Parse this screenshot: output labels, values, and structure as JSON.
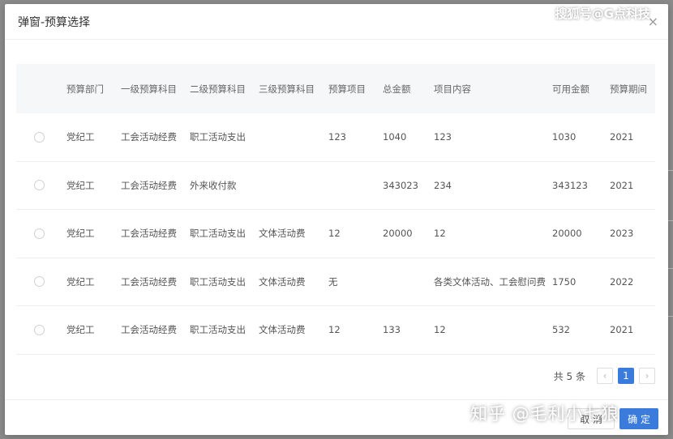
{
  "modal": {
    "title": "弹窗-预算选择",
    "close_glyph": "×"
  },
  "table": {
    "columns": [
      "",
      "预算部门",
      "一级预算科目",
      "二级预算科目",
      "三级预算科目",
      "预算项目",
      "总金额",
      "项目内容",
      "可用金额",
      "预算期间"
    ],
    "rows": [
      {
        "dept": "党纪工",
        "lvl1": "工会活动经费",
        "lvl2": "职工活动支出",
        "lvl3": "",
        "item": "123",
        "total": "1040",
        "content": "123",
        "avail": "1030",
        "period": "2021"
      },
      {
        "dept": "党纪工",
        "lvl1": "工会活动经费",
        "lvl2": "外来收付款",
        "lvl3": "",
        "item": "",
        "total": "343023",
        "content": "234",
        "avail": "343123",
        "period": "2021"
      },
      {
        "dept": "党纪工",
        "lvl1": "工会活动经费",
        "lvl2": "职工活动支出",
        "lvl3": "文体活动费",
        "item": "12",
        "total": "20000",
        "content": "12",
        "avail": "20000",
        "period": "2023"
      },
      {
        "dept": "党纪工",
        "lvl1": "工会活动经费",
        "lvl2": "职工活动支出",
        "lvl3": "文体活动费",
        "item": "无",
        "total": "",
        "content": "各类文体活动、工会慰问费",
        "avail": "1750",
        "period": "2022"
      },
      {
        "dept": "党纪工",
        "lvl1": "工会活动经费",
        "lvl2": "职工活动支出",
        "lvl3": "文体活动费",
        "item": "12",
        "total": "133",
        "content": "12",
        "avail": "532",
        "period": "2021"
      }
    ]
  },
  "pagination": {
    "total_text": "共 5 条",
    "current_page": "1",
    "prev_glyph": "‹",
    "next_glyph": "›"
  },
  "footer": {
    "cancel_label": "取 消",
    "ok_label": "确 定"
  },
  "watermarks": {
    "top": "搜狐号@G点科技",
    "bottom": "知乎 @毛利小七狼"
  },
  "colors": {
    "primary": "#3a7bdc",
    "overlay": "#8c8c8c",
    "header_bg": "#f6f7f9"
  }
}
